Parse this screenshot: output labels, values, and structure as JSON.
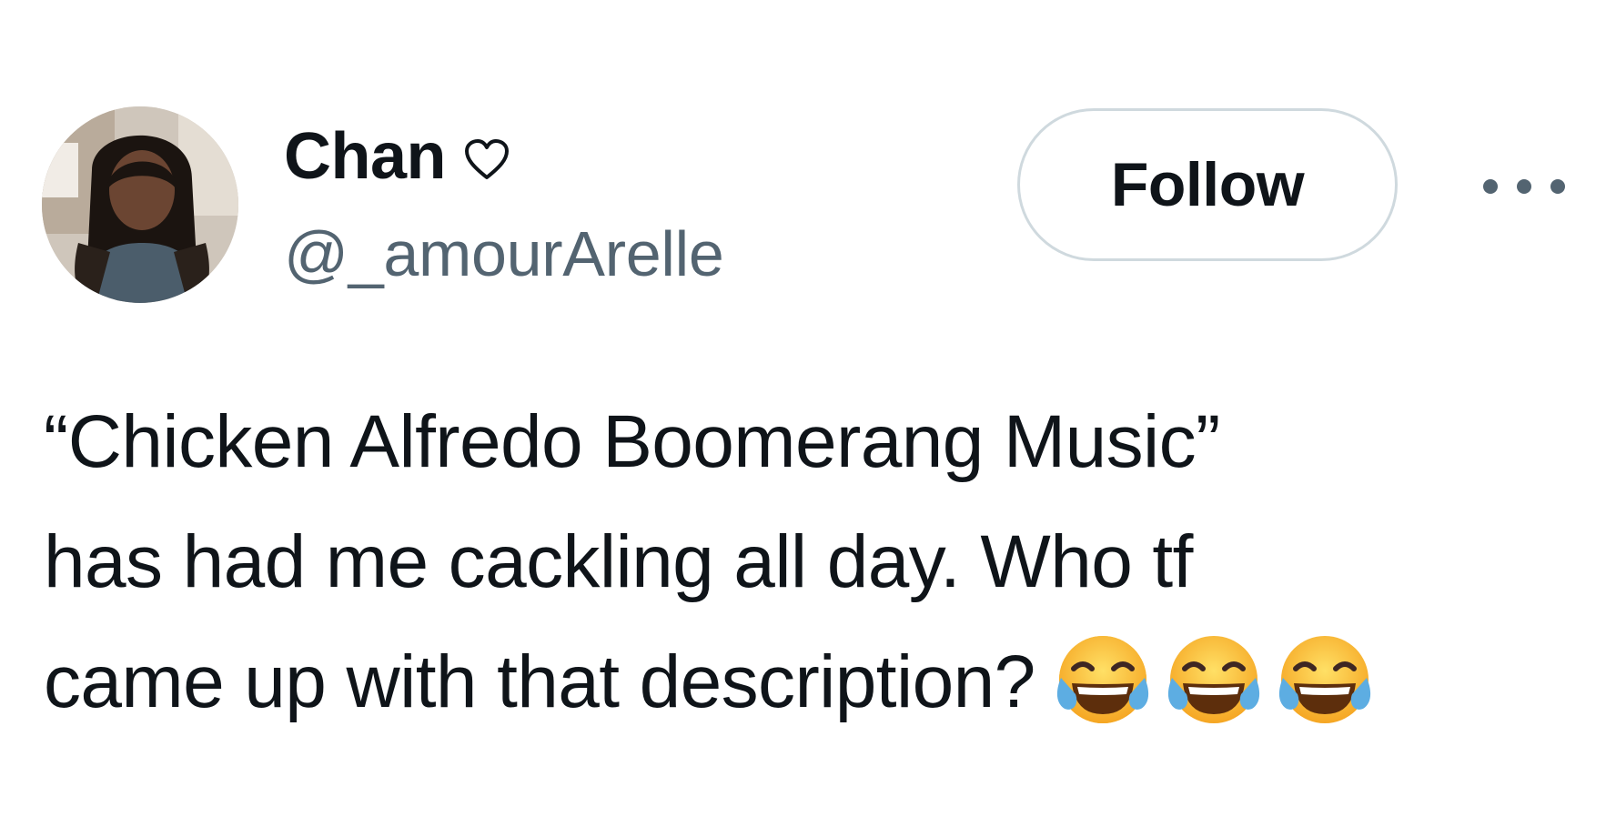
{
  "author": {
    "display_name": "Chan",
    "name_badge_icon": "heart-outline-icon",
    "handle": "@_amourArelle",
    "avatar_icon": "profile-photo"
  },
  "actions": {
    "follow_label": "Follow",
    "more_icon": "more-horizontal-icon"
  },
  "tweet": {
    "lines": [
      "“Chicken Alfredo Boomerang Music”",
      "has had me cackling all day. Who tf",
      "came up with that description?"
    ],
    "emojis": [
      "face-with-tears-of-joy",
      "face-with-tears-of-joy",
      "face-with-tears-of-joy"
    ]
  },
  "colors": {
    "text_primary": "#0f1419",
    "text_secondary": "#536471",
    "button_border": "#cfd9de",
    "background": "#ffffff"
  }
}
